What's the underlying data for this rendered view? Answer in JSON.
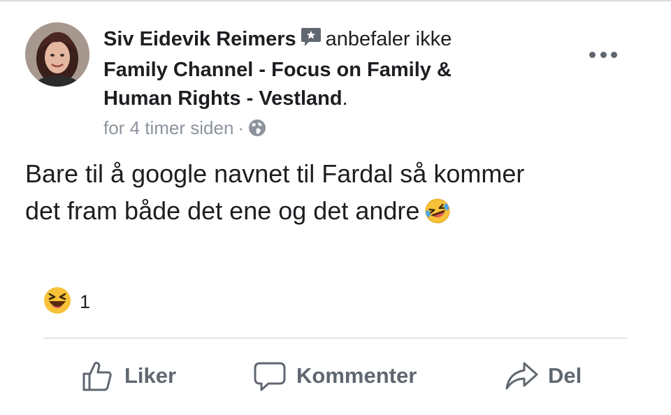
{
  "post": {
    "author": "Siv Eidevik Reimers",
    "verb": "anbefaler ikke",
    "page_line1": "Family Channel - Focus on Family &",
    "page_line2": "Human Rights - Vestland",
    "page_suffix": ".",
    "timestamp": "for 4 timer siden",
    "separator": "·",
    "audience_icon": "globe-icon",
    "body_line1": "Bare til å google navnet til Fardal så kommer",
    "body_line2": "det fram både det ene og det andre",
    "body_emoji": "rolling-on-floor-laughing-emoji"
  },
  "reactions": {
    "icon": "haha-reaction-icon",
    "count": "1"
  },
  "actions": {
    "like": "Liker",
    "comment": "Kommenter",
    "share": "Del"
  },
  "colors": {
    "text": "#1c1e21",
    "secondary": "#8d949e",
    "action": "#606770",
    "divider": "#e3e5e8",
    "emoji_yellow": "#f7c238"
  }
}
